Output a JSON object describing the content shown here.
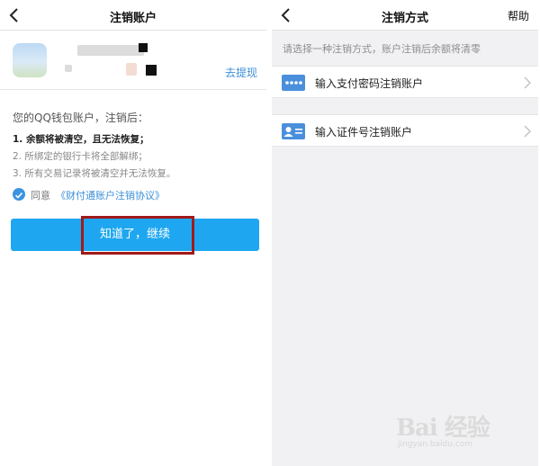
{
  "left_screen": {
    "nav": {
      "title": "注销账户"
    },
    "account": {
      "withdraw_link": "去提现"
    },
    "lead": "您的QQ钱包账户，注销后：",
    "rules": [
      "1. 余额将被清空，且无法恢复；",
      "2. 所绑定的银行卡将全部解绑；",
      "3. 所有交易记录将被清空并无法恢复。"
    ],
    "agreement": {
      "prefix": "同意",
      "link": "《财付通账户注销协议》",
      "checked": true
    },
    "primary_button": "知道了，继续"
  },
  "right_screen": {
    "nav": {
      "title": "注销方式",
      "right_action": "帮助"
    },
    "hint": "请选择一种注销方式，账户注销后余额将清零",
    "methods": [
      {
        "label": "输入支付密码注销账户",
        "icon": "password-card-icon"
      },
      {
        "label": "输入证件号注销账户",
        "icon": "id-card-icon"
      }
    ]
  },
  "watermark": {
    "logo": "Bai 经验",
    "url": "jingyan.baidu.com"
  },
  "colors": {
    "accent": "#1ea7f0",
    "link": "#3b8fd8",
    "highlight_frame": "#a11a1a"
  }
}
